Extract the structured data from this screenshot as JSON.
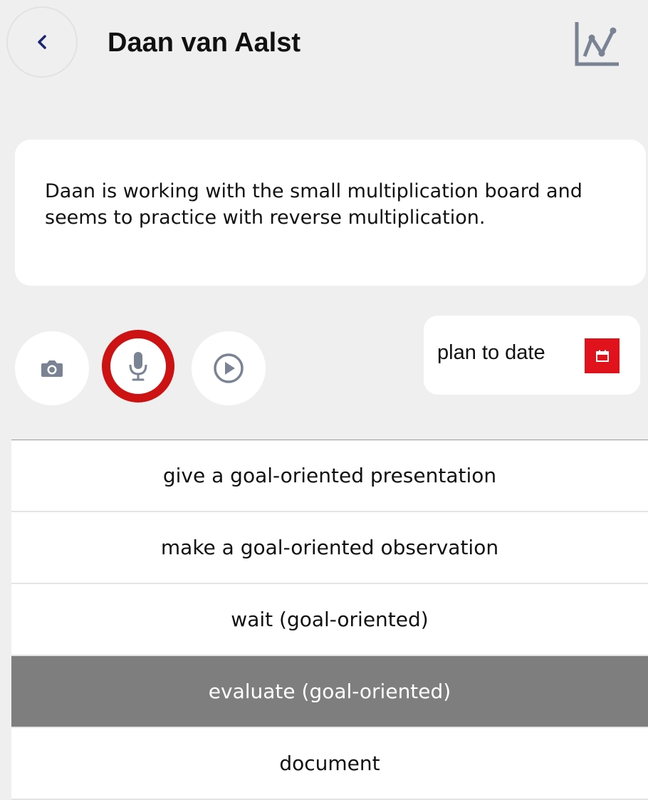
{
  "header": {
    "title": "Daan van Aalst",
    "back_icon": "chevron-left-icon",
    "chart_icon": "line-chart-icon"
  },
  "note": {
    "text": "Daan is working with the small multiplication board and seems to practice with reverse multiplication."
  },
  "media": {
    "camera_icon": "camera-icon",
    "mic_icon": "microphone-icon",
    "play_icon": "play-icon",
    "recording_color": "#cc1212"
  },
  "plan": {
    "label": "plan to date",
    "icon": "calendar-icon",
    "color": "#e0121c"
  },
  "actions": [
    {
      "label": "give a goal-oriented presentation",
      "selected": false
    },
    {
      "label": "make a goal-oriented observation",
      "selected": false
    },
    {
      "label": "wait (goal-oriented)",
      "selected": false
    },
    {
      "label": "evaluate (goal-oriented)",
      "selected": true
    },
    {
      "label": "document",
      "selected": false
    }
  ],
  "colors": {
    "background": "#efefef",
    "selected_row": "#7e7e7e",
    "icon_gray": "#7a8394",
    "back_navy": "#1a2470"
  }
}
